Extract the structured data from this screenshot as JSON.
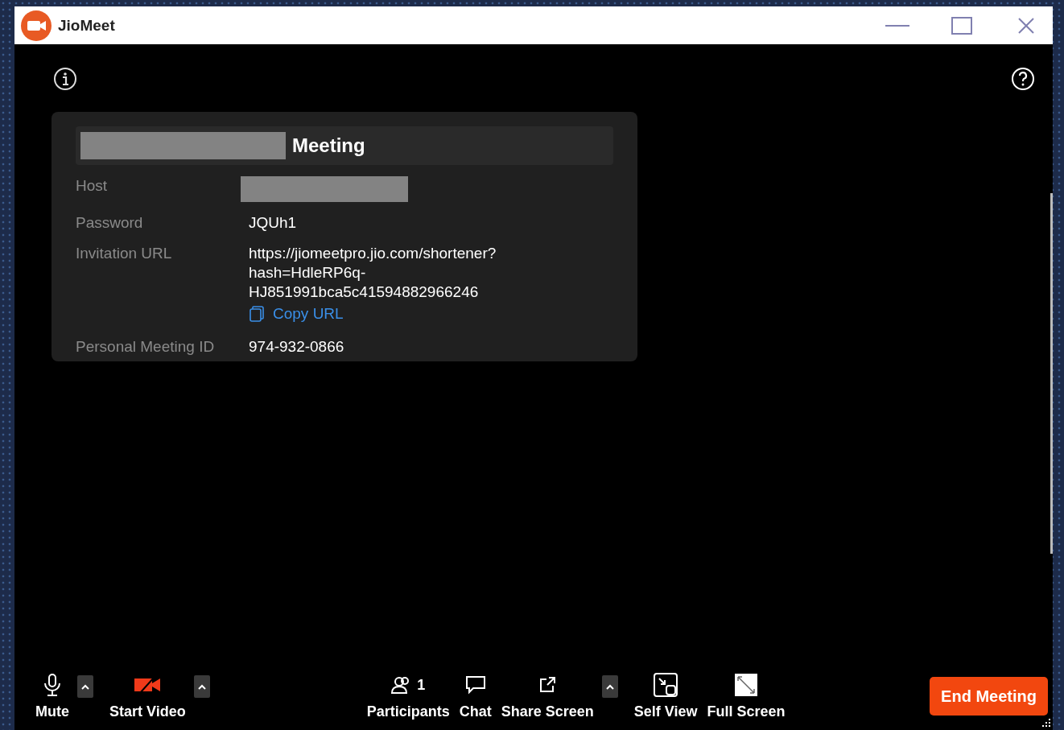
{
  "window": {
    "title": "JioMeet"
  },
  "meeting_card": {
    "title": "Meeting",
    "title_redacted": true,
    "rows": [
      {
        "kind": "redacted",
        "label": "Host"
      },
      {
        "kind": "text",
        "label": "Password",
        "value": "JQUh1"
      },
      {
        "kind": "url",
        "label": "Invitation URL",
        "value": "https://jiomeetpro.jio.com/shortener?\nhash=HdleRP6q-\nHJ851991bca5c41594882966246",
        "link": "Copy URL"
      },
      {
        "kind": "text",
        "label": "Personal Meeting ID",
        "value": "974-932-0866"
      }
    ]
  },
  "toolbar": [
    {
      "kind": "mic",
      "label": "Mute",
      "caret": true
    },
    {
      "kind": "video-off",
      "label": "Start Video",
      "caret": true
    },
    {
      "kind": "participants",
      "label": "Participants",
      "count": "1",
      "caret": false
    },
    {
      "kind": "chat",
      "label": "Chat",
      "caret": false
    },
    {
      "kind": "share",
      "label": "Share Screen",
      "caret": true
    },
    {
      "kind": "self-view",
      "label": "Self View",
      "caret": false
    },
    {
      "kind": "full-screen",
      "label": "Full Screen",
      "caret": false
    }
  ],
  "end_button": "End Meeting"
}
